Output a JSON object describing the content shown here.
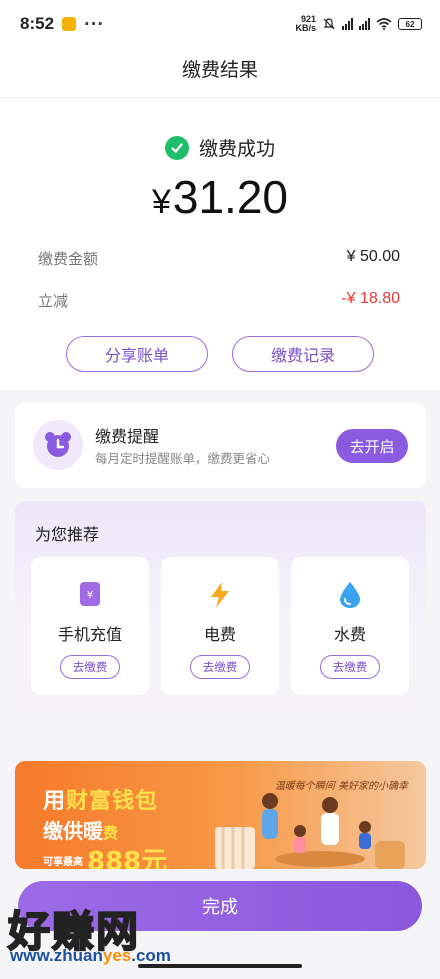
{
  "status_bar": {
    "time": "8:52",
    "more": "···",
    "speed_value": "921",
    "speed_unit": "KB/s",
    "battery": "62"
  },
  "header": {
    "title": "缴费结果"
  },
  "result": {
    "status_text": "缴费成功",
    "currency": "¥",
    "amount": "31.20",
    "rows": [
      {
        "label": "缴费金额",
        "value": "¥ 50.00"
      },
      {
        "label": "立减",
        "value": "-¥ 18.80"
      }
    ],
    "share_button": "分享账单",
    "records_button": "缴费记录"
  },
  "reminder": {
    "title": "缴费提醒",
    "subtitle": "每月定时提醒账单，缴费更省心",
    "button": "去开启"
  },
  "recommend": {
    "title": "为您推荐",
    "items": [
      {
        "label": "手机充值",
        "button": "去缴费",
        "icon": "phone-icon"
      },
      {
        "label": "电费",
        "button": "去缴费",
        "icon": "lightning-icon"
      },
      {
        "label": "水费",
        "button": "去缴费",
        "icon": "water-drop-icon"
      }
    ]
  },
  "banner": {
    "line1_a": "用",
    "line1_b": "财富钱包",
    "line2_a": "缴供暖",
    "line2_b": "费",
    "line3_small": "可享最高",
    "line3": "888元",
    "slogan": "温暖每个瞬间 美好家的小确幸"
  },
  "done_button": "完成",
  "watermark": {
    "text": "好赚网",
    "url_a": "www.zhuan",
    "url_b": "yes",
    "url_c": ".com"
  },
  "colors": {
    "accent": "#8a5ae0",
    "success": "#1fbe6a",
    "discount": "#e53935"
  }
}
